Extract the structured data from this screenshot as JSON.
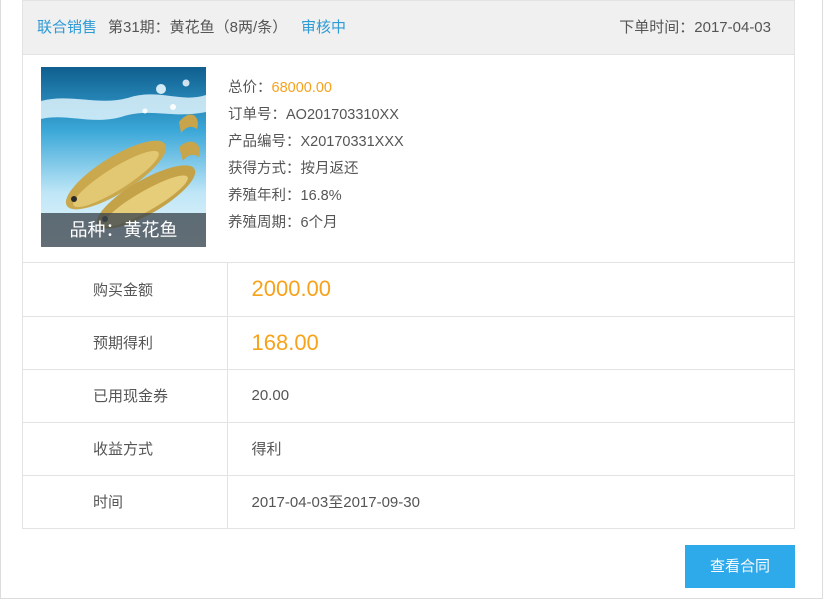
{
  "header": {
    "source": "联合销售",
    "product": "第31期：黄花鱼（8两/条）",
    "status": "审核中",
    "order_time": "下单时间：2017-04-03"
  },
  "thumbnail": {
    "caption": "品种：黄花鱼"
  },
  "details": {
    "total_label": "总价：",
    "total_value": "68000.00",
    "order_no": "订单号：AO201703310XX",
    "product_no": "产品编号：X20170331XXX",
    "acquire_method": "获得方式：按月返还",
    "annual_rate": "养殖年利：16.8%",
    "period": "养殖周期：6个月"
  },
  "summary": {
    "rows": [
      {
        "label": "购买金额",
        "value": "2000.00"
      },
      {
        "label": "预期得利",
        "value": "168.00"
      },
      {
        "label": "已用现金券",
        "value": "20.00"
      },
      {
        "label": "收益方式",
        "value": "得利"
      },
      {
        "label": "时间",
        "value": "2017-04-03至2017-09-30"
      }
    ]
  },
  "actions": {
    "view_contract": "查看合同"
  },
  "colors": {
    "accent_blue": "#2e9ad6",
    "button_blue": "#2ea9e9",
    "price_orange": "#f7a21b"
  }
}
